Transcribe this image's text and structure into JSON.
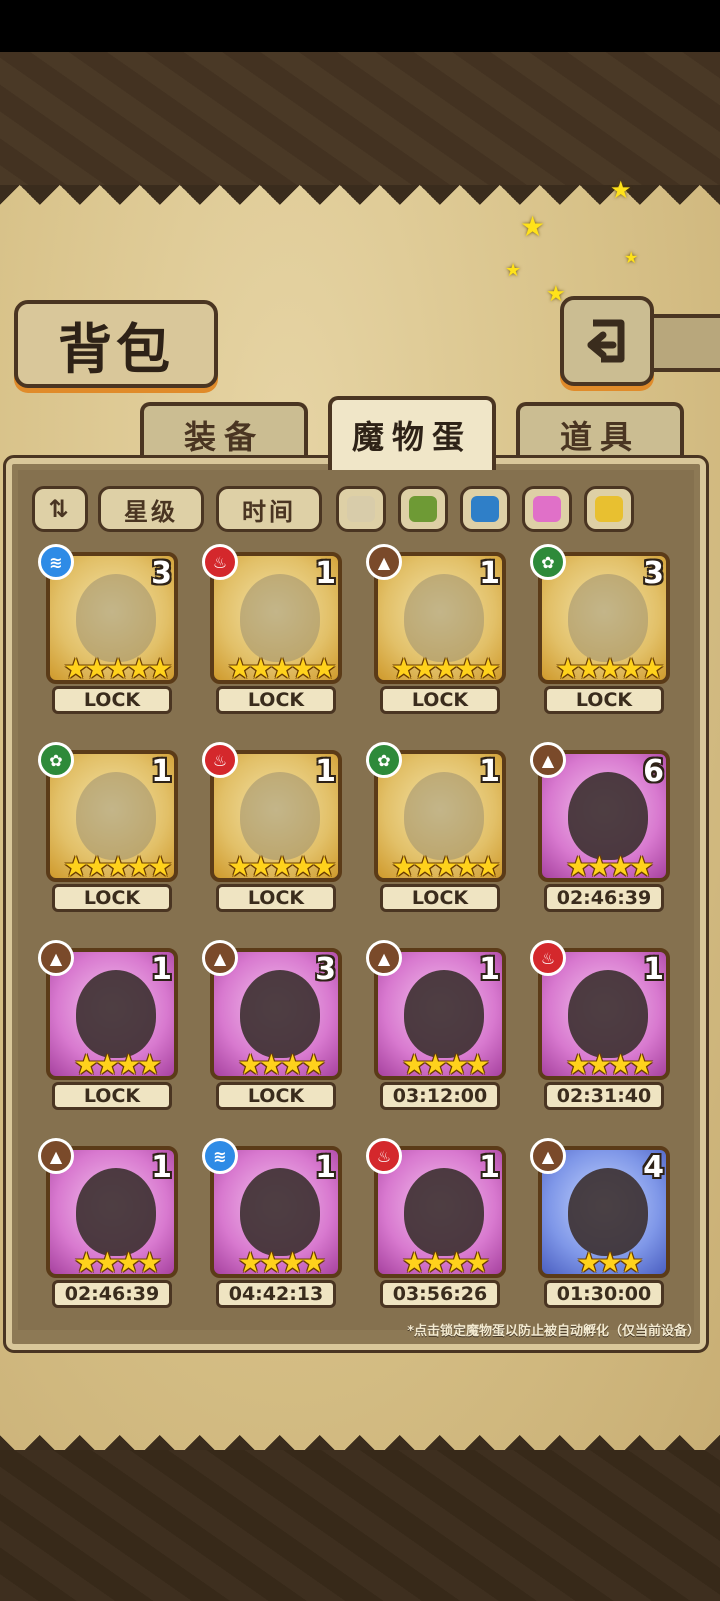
{
  "title": "背包",
  "tabs": [
    {
      "label": "装备",
      "active": false
    },
    {
      "label": "魔物蛋",
      "active": true
    },
    {
      "label": "道具",
      "active": false
    }
  ],
  "filters": {
    "sort_icon": "sort-toggle-icon",
    "star_label": "星级",
    "time_label": "时间",
    "swatches": [
      "#d8ccaa",
      "#6e9a35",
      "#2f7fc8",
      "#e070c8",
      "#e8c030"
    ]
  },
  "eggs": [
    {
      "element": "water",
      "rarity": "gold",
      "count": "3",
      "stars": "★★★★★",
      "status": "LOCK"
    },
    {
      "element": "fire",
      "rarity": "gold",
      "count": "1",
      "stars": "★★★★★",
      "status": "LOCK"
    },
    {
      "element": "earth",
      "rarity": "gold",
      "count": "1",
      "stars": "★★★★★",
      "status": "LOCK"
    },
    {
      "element": "grass",
      "rarity": "gold",
      "count": "3",
      "stars": "★★★★★",
      "status": "LOCK"
    },
    {
      "element": "grass",
      "rarity": "gold",
      "count": "1",
      "stars": "★★★★★",
      "status": "LOCK"
    },
    {
      "element": "fire",
      "rarity": "gold",
      "count": "1",
      "stars": "★★★★★",
      "status": "LOCK"
    },
    {
      "element": "grass",
      "rarity": "gold",
      "count": "1",
      "stars": "★★★★★",
      "status": "LOCK"
    },
    {
      "element": "earth",
      "rarity": "pink",
      "count": "6",
      "stars": "★★★★",
      "status": "02:46:39"
    },
    {
      "element": "earth",
      "rarity": "pink",
      "count": "1",
      "stars": "★★★★",
      "status": "LOCK"
    },
    {
      "element": "earth",
      "rarity": "pink",
      "count": "3",
      "stars": "★★★★",
      "status": "LOCK"
    },
    {
      "element": "earth",
      "rarity": "pink",
      "count": "1",
      "stars": "★★★★",
      "status": "03:12:00"
    },
    {
      "element": "fire",
      "rarity": "pink",
      "count": "1",
      "stars": "★★★★",
      "status": "02:31:40"
    },
    {
      "element": "earth",
      "rarity": "pink",
      "count": "1",
      "stars": "★★★★",
      "status": "02:46:39"
    },
    {
      "element": "water",
      "rarity": "pink",
      "count": "1",
      "stars": "★★★★",
      "status": "04:42:13"
    },
    {
      "element": "fire",
      "rarity": "pink",
      "count": "1",
      "stars": "★★★★",
      "status": "03:56:26"
    },
    {
      "element": "earth",
      "rarity": "blue",
      "count": "4",
      "stars": "★★★",
      "status": "01:30:00"
    }
  ],
  "element_colors": {
    "water": "#2e8be6",
    "fire": "#d4282c",
    "earth": "#7a4a2a",
    "grass": "#2e8a3a"
  },
  "element_glyphs": {
    "water": "≋",
    "fire": "♨",
    "earth": "▲",
    "grass": "✿"
  },
  "footnote": "*点击锁定魔物蛋以防止被自动孵化（仅当前设备）"
}
